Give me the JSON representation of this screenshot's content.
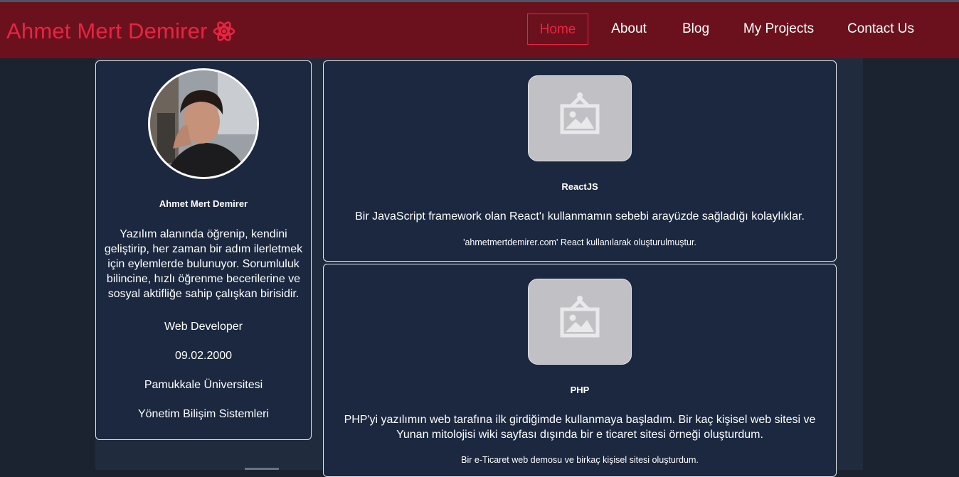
{
  "brand": {
    "name": "Ahmet Mert Demirer",
    "icon": "react-atom-icon",
    "color": "#ea2341"
  },
  "nav": {
    "items": [
      {
        "label": "Home",
        "active": true
      },
      {
        "label": "About",
        "active": false
      },
      {
        "label": "Blog",
        "active": false
      },
      {
        "label": "My Projects",
        "active": false
      },
      {
        "label": "Contact Us",
        "active": false
      }
    ]
  },
  "profile": {
    "name": "Ahmet Mert Demirer",
    "bio": "Yazılım alanında öğrenip, kendini geliştirip, her zaman bir adım ilerletmek için eylemlerde bulunuyor. Sorumluluk bilincine, hızlı öğrenme becerilerine ve sosyal aktifliğe sahip çalışkan birisidir.",
    "role": "Web Developer",
    "birthdate": "09.02.2000",
    "university": "Pamukkale Üniversitesi",
    "department": "Yönetim Bilişim Sistemleri"
  },
  "projects": [
    {
      "title": "ReactJS",
      "description": "Bir JavaScript framework olan React'ı kullanmamın sebebi arayüzde sağladığı kolaylıklar.",
      "note": "'ahmetmertdemirer.com' React kullanılarak oluşturulmuştur.",
      "image_icon": "image-placeholder-icon"
    },
    {
      "title": "PHP",
      "description": "PHP'yi yazılımın web tarafına ilk girdiğimde kullanmaya başladım. Bir kaç kişisel web sitesi ve Yunan mitolojisi wiki sayfası dışında bir e ticaret sitesi örneği oluşturdum.",
      "note": "Bir e-Ticaret web demosu ve birkaç kişisel sitesi oluşturdum.",
      "image_icon": "image-placeholder-icon"
    }
  ],
  "colors": {
    "navbar": "#6b111e",
    "accent": "#ea2341",
    "background": "#1b2230",
    "card": "#1b2840"
  }
}
